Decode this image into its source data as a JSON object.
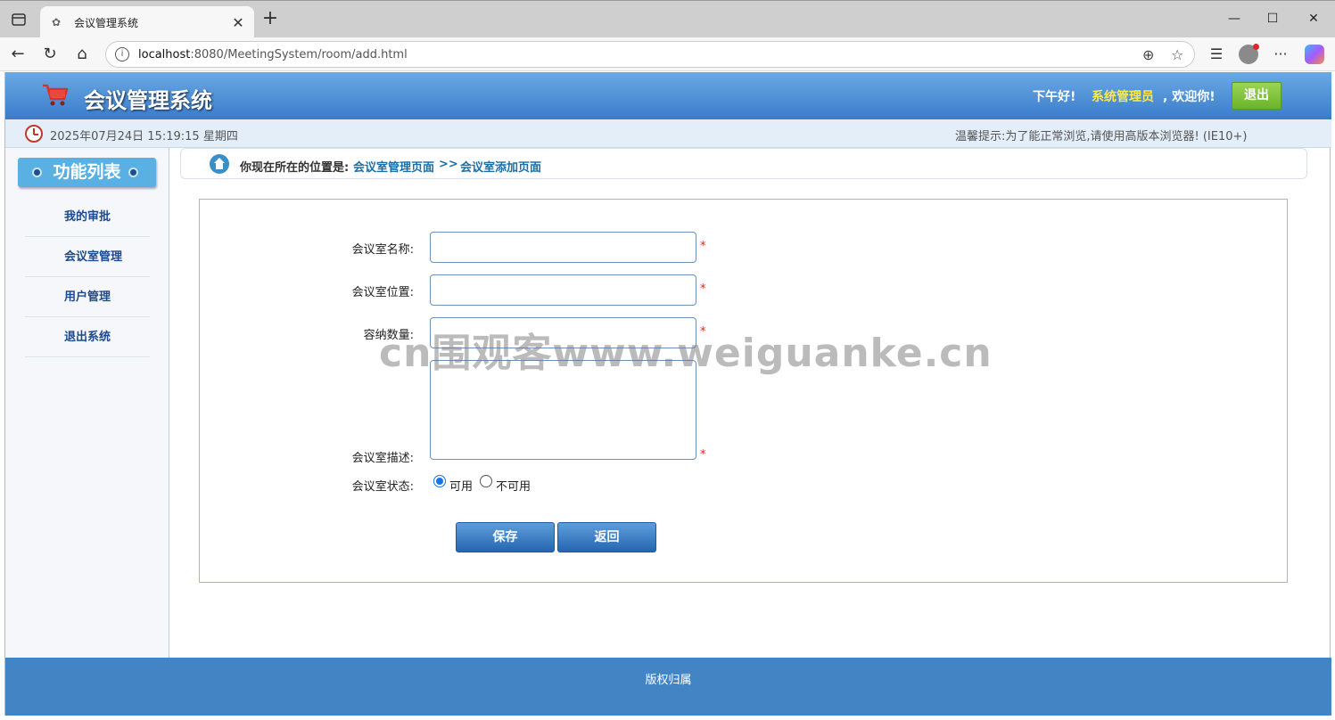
{
  "browser": {
    "tab_title": "会议管理系统",
    "url_host": "localhost",
    "url_path": ":8080/MeetingSystem/room/add.html"
  },
  "header": {
    "app_title": "会议管理系统",
    "greeting": "下午好!",
    "username": "系统管理员",
    "welcome": ", 欢迎你!",
    "logout_label": "退出"
  },
  "status": {
    "datetime": "2025年07月24日 15:19:15 星期四",
    "tip": "温馨提示:为了能正常浏览,请使用高版本浏览器! (IE10+)"
  },
  "sidebar": {
    "title": "功能列表",
    "items": [
      {
        "label": "我的审批"
      },
      {
        "label": "会议室管理"
      },
      {
        "label": "用户管理"
      },
      {
        "label": "退出系统"
      }
    ]
  },
  "breadcrumb": {
    "prefix": "你现在所在的位置是:",
    "crumbs": [
      "会议室管理页面",
      ">>",
      "会议室添加页面"
    ]
  },
  "form": {
    "name_label": "会议室名称:",
    "location_label": "会议室位置:",
    "capacity_label": "容纳数量:",
    "description_label": "会议室描述:",
    "status_label": "会议室状态:",
    "required_mark": "*",
    "status_options": [
      {
        "label": "可用",
        "checked": true
      },
      {
        "label": "不可用",
        "checked": false
      }
    ],
    "save_label": "保存",
    "back_label": "返回"
  },
  "footer": {
    "text": "版权归属"
  },
  "watermark": "cn围观客www.weiguanke.cn",
  "colors": {
    "header_blue": "#3a7ccc",
    "footer_blue": "#4385c4",
    "logout_green": "#6ab42a",
    "username_yellow": "#ffe84a",
    "form_border": "#b5c945"
  }
}
